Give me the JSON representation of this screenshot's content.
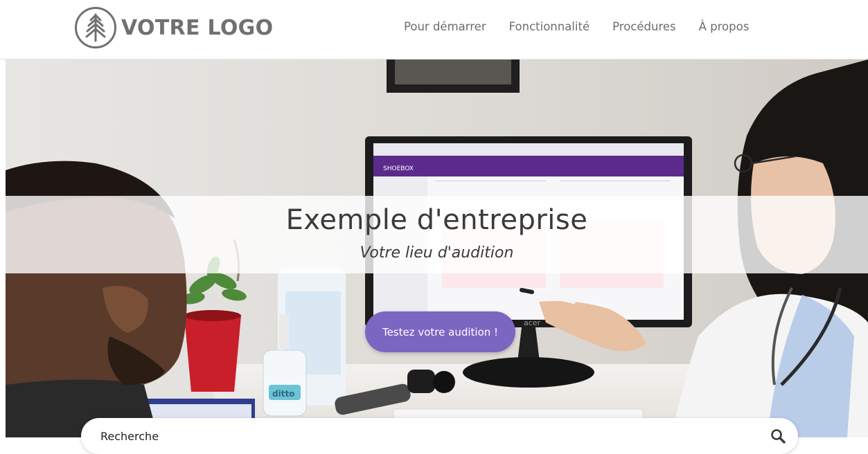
{
  "header": {
    "logo_text": "VOTRE LOGO",
    "logo_icon": "tree-icon",
    "nav": [
      {
        "label": "Pour démarrer"
      },
      {
        "label": "Fonctionnalité"
      },
      {
        "label": "Procédures"
      },
      {
        "label": "À propos"
      }
    ]
  },
  "hero": {
    "title": "Exemple d'entreprise",
    "subtitle": "Votre lieu d'audition",
    "cta_label": "Testez votre audition !",
    "monitor_app_name": "SHOEBOX",
    "monitor_brand": "acer",
    "sanitizer_label": "ditto"
  },
  "search": {
    "placeholder": "Recherche",
    "icon": "search-icon"
  },
  "colors": {
    "accent": "#7b66c2",
    "nav_text": "#6d6d6d",
    "logo": "#707070"
  }
}
